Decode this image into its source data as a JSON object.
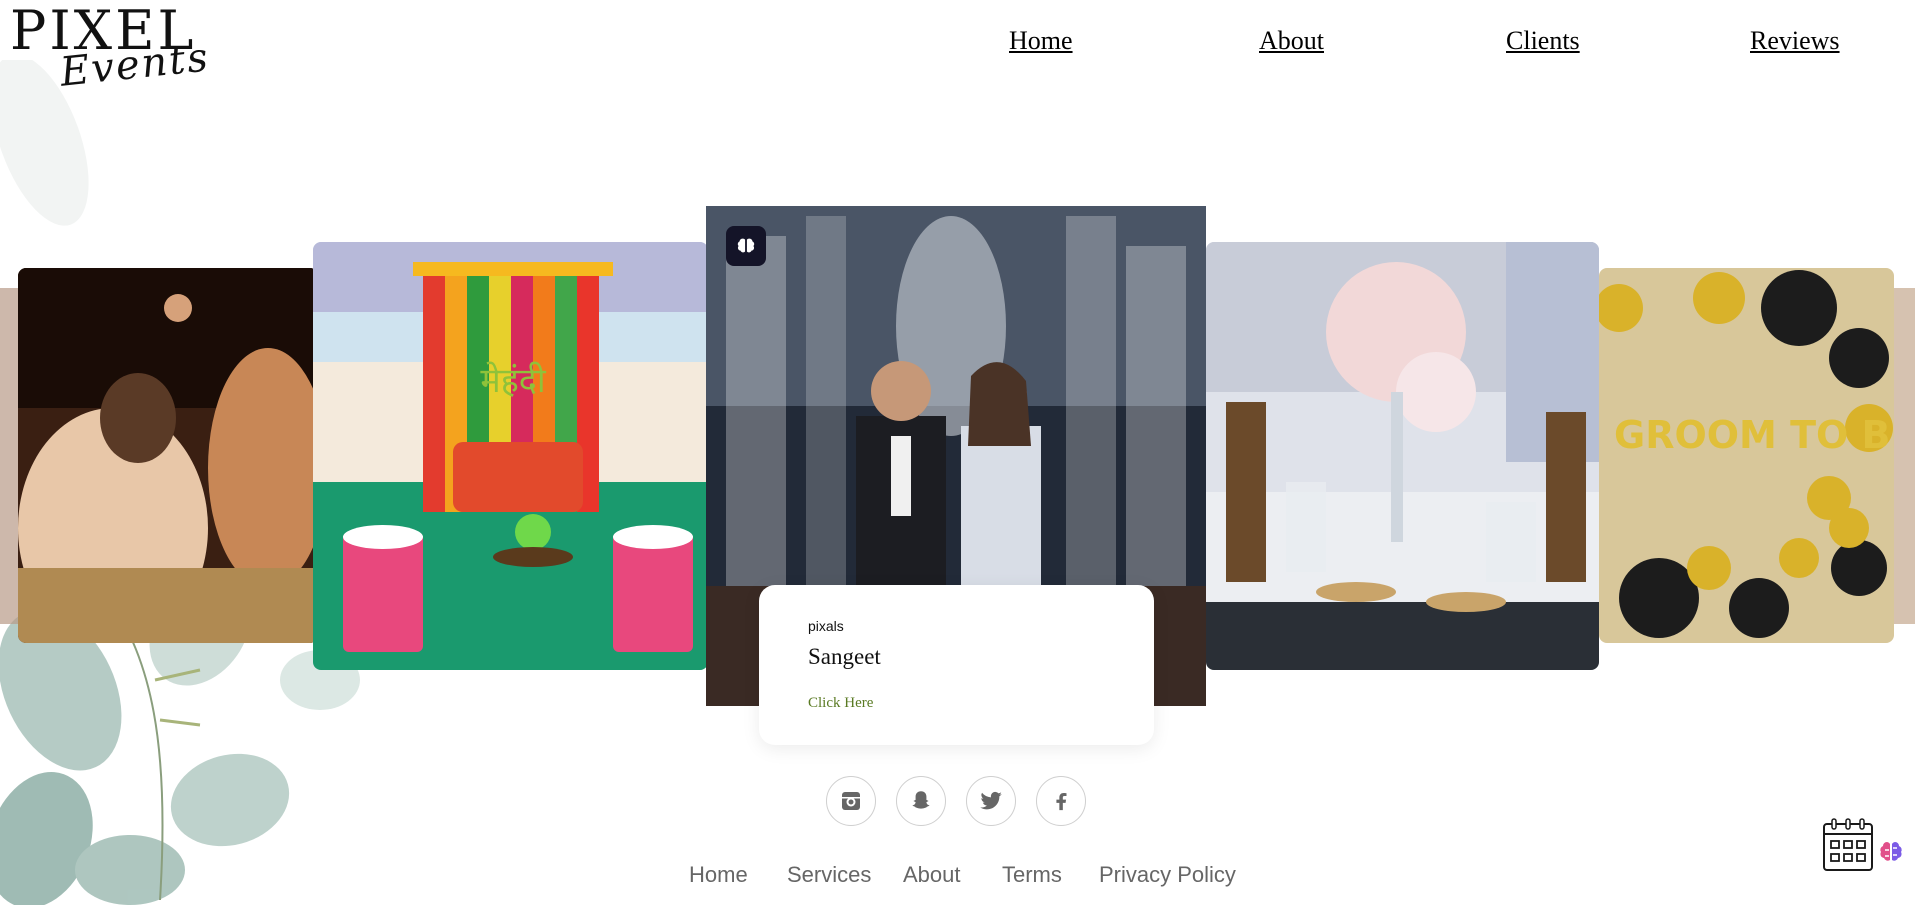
{
  "header": {
    "logo": {
      "word": "PIXEL",
      "script": "Events"
    },
    "nav": [
      {
        "label": "Home"
      },
      {
        "label": "About"
      },
      {
        "label": "Clients"
      },
      {
        "label": "Reviews"
      }
    ]
  },
  "carousel": {
    "slides": [
      {
        "scene": "haldi-ceremony-photo"
      },
      {
        "scene": "mehndi-decor-photo",
        "sign": "मेहंदी"
      },
      {
        "scene": "sangeet-couple-fireworks-photo"
      },
      {
        "scene": "floral-table-setting-photo"
      },
      {
        "scene": "groom-to-be-balloons-photo",
        "sign": "GROOM TO BE"
      }
    ],
    "active_card": {
      "kicker": "pixals",
      "title": "Sangeet",
      "link": "Click Here"
    }
  },
  "social": [
    {
      "icon": "instagram-icon"
    },
    {
      "icon": "snapchat-icon"
    },
    {
      "icon": "twitter-icon"
    },
    {
      "icon": "facebook-icon"
    }
  ],
  "footer": {
    "links": [
      {
        "label": "Home"
      },
      {
        "label": "Services"
      },
      {
        "label": "About"
      },
      {
        "label": "Terms"
      },
      {
        "label": "Privacy Policy"
      }
    ]
  },
  "colors": {
    "link_green": "#5a7a23",
    "badge_dark": "#141428",
    "footer_text": "#666666"
  }
}
